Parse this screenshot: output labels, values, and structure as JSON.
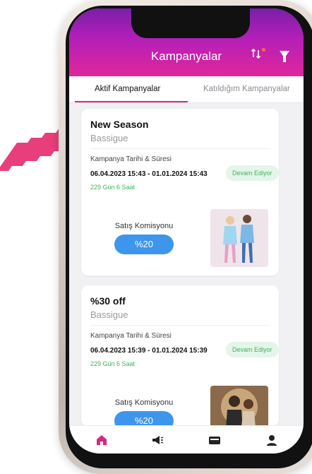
{
  "header": {
    "title": "Kampanyalar",
    "sort_icon": "sort-icon",
    "filter_icon": "filter-icon"
  },
  "tabs": {
    "active": "Aktif Kampanyalar",
    "inactive": "Katıldığım Kampanyalar"
  },
  "campaigns": [
    {
      "title": "New Season",
      "brand": "Bassigue",
      "date_label": "Kampanya Tarihi & Süresi",
      "dates": "06.04.2023 15:43 - 01.01.2024 15:43",
      "remaining": "229 Gün 6 Saat",
      "status": "Devam Ediyor",
      "commission_label": "Satış Komisyonu",
      "commission_value": "%20"
    },
    {
      "title": "%30 off",
      "brand": "Bassigue",
      "date_label": "Kampanya Tarihi & Süresi",
      "dates": "06.04.2023 15:39 - 01.01.2024 15:39",
      "remaining": "229 Gün 6 Saat",
      "status": "Devam Ediyor",
      "commission_label": "Satış Komisyonu",
      "commission_value": "%20"
    }
  ],
  "nav": {
    "items": [
      "home-icon",
      "megaphone-icon",
      "wallet-icon",
      "profile-icon"
    ],
    "active": "home-icon"
  },
  "colors": {
    "header_start": "#7a1fa8",
    "header_end": "#e0279a",
    "accent": "#d6287f",
    "status_green": "#3fb35a",
    "pill_blue": "#3d96ec",
    "chevron": "#e83e7c"
  }
}
